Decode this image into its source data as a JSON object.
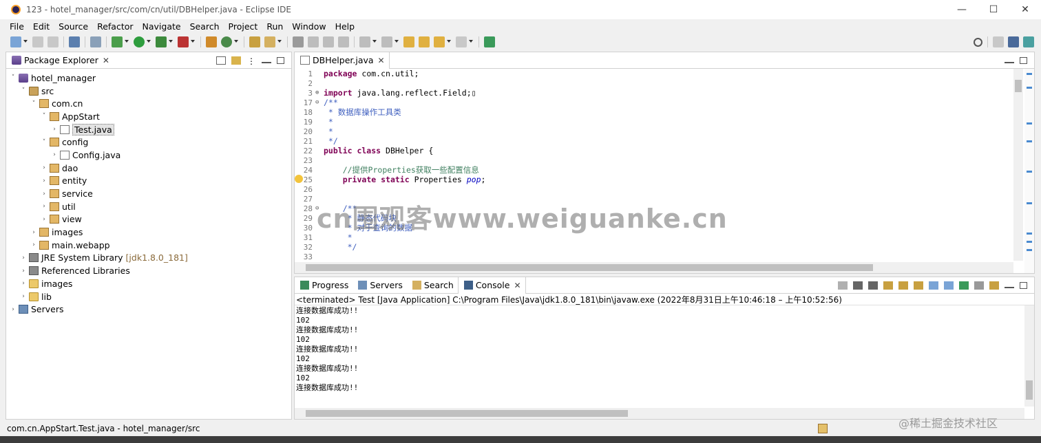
{
  "window": {
    "title": "123 - hotel_manager/src/com/cn/util/DBHelper.java - Eclipse IDE",
    "minimize": "—",
    "maximize": "☐",
    "close": "✕"
  },
  "menu": [
    "File",
    "Edit",
    "Source",
    "Refactor",
    "Navigate",
    "Search",
    "Project",
    "Run",
    "Window",
    "Help"
  ],
  "package_explorer": {
    "tab_label": "Package Explorer",
    "tree": [
      {
        "label": "hotel_manager",
        "depth": 0,
        "chev": "˅",
        "icon": "project"
      },
      {
        "label": "src",
        "depth": 1,
        "chev": "˅",
        "icon": "src"
      },
      {
        "label": "com.cn",
        "depth": 2,
        "chev": "˅",
        "icon": "pkg"
      },
      {
        "label": "AppStart",
        "depth": 3,
        "chev": "˅",
        "icon": "pkg"
      },
      {
        "label": "Test.java",
        "depth": 4,
        "chev": "›",
        "icon": "java",
        "selected": true
      },
      {
        "label": "config",
        "depth": 3,
        "chev": "˅",
        "icon": "pkg"
      },
      {
        "label": "Config.java",
        "depth": 4,
        "chev": "›",
        "icon": "java"
      },
      {
        "label": "dao",
        "depth": 3,
        "chev": "›",
        "icon": "pkg"
      },
      {
        "label": "entity",
        "depth": 3,
        "chev": "›",
        "icon": "pkg"
      },
      {
        "label": "service",
        "depth": 3,
        "chev": "›",
        "icon": "pkg"
      },
      {
        "label": "util",
        "depth": 3,
        "chev": "›",
        "icon": "pkg"
      },
      {
        "label": "view",
        "depth": 3,
        "chev": "›",
        "icon": "pkg"
      },
      {
        "label": "images",
        "depth": 2,
        "chev": "›",
        "icon": "pkg"
      },
      {
        "label": "main.webapp",
        "depth": 2,
        "chev": "›",
        "icon": "pkg"
      },
      {
        "label": "JRE System Library",
        "suffix": "[jdk1.8.0_181]",
        "depth": 1,
        "chev": "›",
        "icon": "lib"
      },
      {
        "label": "Referenced Libraries",
        "depth": 1,
        "chev": "›",
        "icon": "lib"
      },
      {
        "label": "images",
        "depth": 1,
        "chev": "›",
        "icon": "folder"
      },
      {
        "label": "lib",
        "depth": 1,
        "chev": "›",
        "icon": "folder"
      },
      {
        "label": "Servers",
        "depth": 0,
        "chev": "›",
        "icon": "server"
      }
    ]
  },
  "editor": {
    "tab_label": "DBHelper.java",
    "lines": [
      {
        "n": "1",
        "fold": "",
        "html": "<span class='kw'>package</span> com.cn.util;"
      },
      {
        "n": "2",
        "fold": "",
        "html": ""
      },
      {
        "n": "3",
        "fold": "⊕",
        "html": "<span class='kw'>import</span> java.lang.reflect.Field;▯"
      },
      {
        "n": "17",
        "fold": "⊖",
        "html": "<span class='cmj'>/**</span>"
      },
      {
        "n": "18",
        "fold": "",
        "html": "<span class='cmj'> * 数据库操作工具类</span>"
      },
      {
        "n": "19",
        "fold": "",
        "html": "<span class='cmj'> *</span>"
      },
      {
        "n": "20",
        "fold": "",
        "html": "<span class='cmj'> *</span>"
      },
      {
        "n": "21",
        "fold": "",
        "html": "<span class='cmj'> */</span>"
      },
      {
        "n": "22",
        "fold": "",
        "html": "<span class='kw'>public class</span> DBHelper {"
      },
      {
        "n": "23",
        "fold": "",
        "html": ""
      },
      {
        "n": "24",
        "fold": "",
        "html": "    <span class='cm'>//提供Properties获取一些配置信息</span>"
      },
      {
        "n": "25",
        "fold": "",
        "html": "    <span class='kw'>private static</span> Properties <span class='fld'>pop</span>;"
      },
      {
        "n": "26",
        "fold": "",
        "html": ""
      },
      {
        "n": "27",
        "fold": "",
        "html": ""
      },
      {
        "n": "28",
        "fold": "⊖",
        "html": "    <span class='cmj'>/**</span>"
      },
      {
        "n": "29",
        "fold": "",
        "html": "<span class='cmj'>     * 静态代码块</span>"
      },
      {
        "n": "30",
        "fold": "",
        "html": "<span class='cmj'>     * 对于查询的数据</span>"
      },
      {
        "n": "31",
        "fold": "",
        "html": "<span class='cmj'>     *</span>"
      },
      {
        "n": "32",
        "fold": "",
        "html": "<span class='cmj'>     */</span>"
      },
      {
        "n": "33",
        "fold": "",
        "html": ""
      }
    ]
  },
  "watermark": "cn围观客www.weiguanke.cn",
  "console": {
    "tabs": [
      "Progress",
      "Servers",
      "Search",
      "Console"
    ],
    "header": "<terminated> Test [Java Application] C:\\Program Files\\Java\\jdk1.8.0_181\\bin\\javaw.exe  (2022年8月31日上午10:46:18 – 上午10:52:56)",
    "output": [
      "连接数据库成功!!",
      "102",
      "连接数据库成功!!",
      "102",
      "连接数据库成功!!",
      "102",
      "连接数据库成功!!",
      "102",
      "连接数据库成功!!"
    ]
  },
  "status": {
    "path": "com.cn.AppStart.Test.java - hotel_manager/src"
  },
  "juejin_watermark": "@稀土掘金技术社区"
}
